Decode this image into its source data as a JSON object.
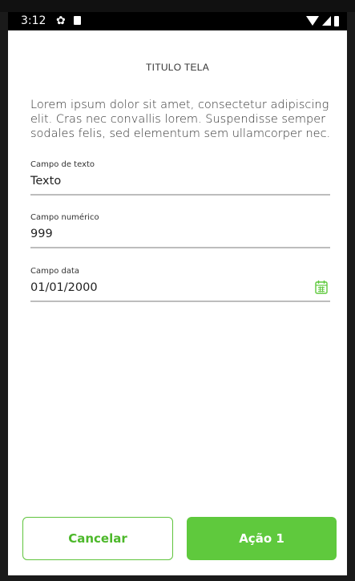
{
  "status_bar": {
    "time": "3:12",
    "icons": [
      "gear-icon",
      "sd-card-icon",
      "wifi-icon",
      "signal-icon",
      "battery-icon"
    ]
  },
  "screen": {
    "title": "TITULO TELA",
    "description": "Lorem ipsum dolor sit amet, consectetur adipiscing elit. Cras nec convallis lorem. Suspendisse semper sodales felis, sed elementum sem ullamcorper nec."
  },
  "fields": {
    "text": {
      "label": "Campo de texto",
      "value": "Texto"
    },
    "number": {
      "label": "Campo numérico",
      "value": "999"
    },
    "date": {
      "label": "Campo data",
      "value": "01/01/2000",
      "icon": "calendar-icon"
    }
  },
  "buttons": {
    "cancel_label": "Cancelar",
    "action_label": "Ação 1"
  },
  "colors": {
    "accent": "#5fc93d",
    "accent_text": "#4cb82a",
    "status_bar": "#000000"
  }
}
